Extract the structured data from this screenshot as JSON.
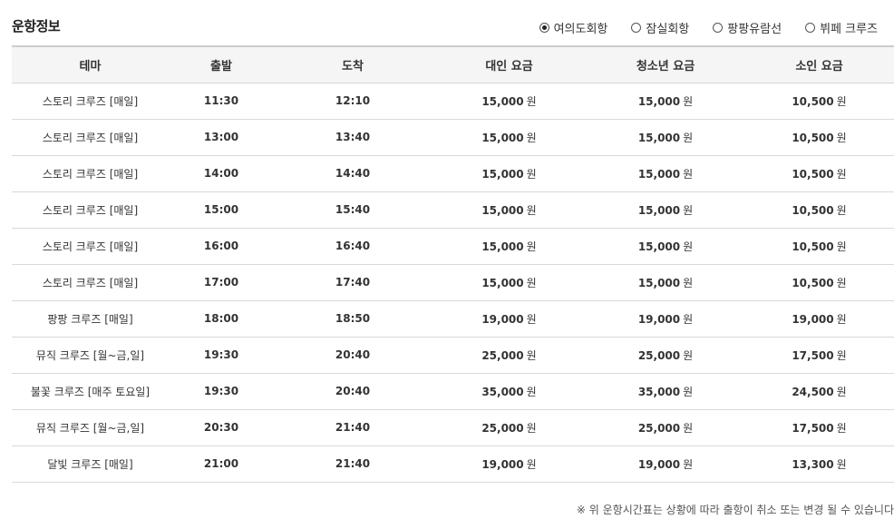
{
  "header": {
    "title": "운항정보"
  },
  "routes": [
    {
      "label": "여의도회항",
      "selected": true
    },
    {
      "label": "잠실회항",
      "selected": false
    },
    {
      "label": "팡팡유람선",
      "selected": false
    },
    {
      "label": "뷔페 크루즈",
      "selected": false
    }
  ],
  "table": {
    "columns": [
      "테마",
      "출발",
      "도착",
      "대인 요금",
      "청소년 요금",
      "소인 요금"
    ],
    "currency_unit": "원",
    "rows": [
      {
        "theme": "스토리 크루즈 [매일]",
        "depart": "11:30",
        "arrive": "12:10",
        "adult": "15,000",
        "youth": "15,000",
        "child": "10,500"
      },
      {
        "theme": "스토리 크루즈 [매일]",
        "depart": "13:00",
        "arrive": "13:40",
        "adult": "15,000",
        "youth": "15,000",
        "child": "10,500"
      },
      {
        "theme": "스토리 크루즈 [매일]",
        "depart": "14:00",
        "arrive": "14:40",
        "adult": "15,000",
        "youth": "15,000",
        "child": "10,500"
      },
      {
        "theme": "스토리 크루즈 [매일]",
        "depart": "15:00",
        "arrive": "15:40",
        "adult": "15,000",
        "youth": "15,000",
        "child": "10,500"
      },
      {
        "theme": "스토리 크루즈 [매일]",
        "depart": "16:00",
        "arrive": "16:40",
        "adult": "15,000",
        "youth": "15,000",
        "child": "10,500"
      },
      {
        "theme": "스토리 크루즈 [매일]",
        "depart": "17:00",
        "arrive": "17:40",
        "adult": "15,000",
        "youth": "15,000",
        "child": "10,500"
      },
      {
        "theme": "팡팡 크루즈 [매일]",
        "depart": "18:00",
        "arrive": "18:50",
        "adult": "19,000",
        "youth": "19,000",
        "child": "19,000"
      },
      {
        "theme": "뮤직 크루즈 [월~금,일]",
        "depart": "19:30",
        "arrive": "20:40",
        "adult": "25,000",
        "youth": "25,000",
        "child": "17,500"
      },
      {
        "theme": "불꽃 크루즈 [매주 토요일]",
        "depart": "19:30",
        "arrive": "20:40",
        "adult": "35,000",
        "youth": "35,000",
        "child": "24,500"
      },
      {
        "theme": "뮤직 크루즈 [월~금,일]",
        "depart": "20:30",
        "arrive": "21:40",
        "adult": "25,000",
        "youth": "25,000",
        "child": "17,500"
      },
      {
        "theme": "달빛 크루즈 [매일]",
        "depart": "21:00",
        "arrive": "21:40",
        "adult": "19,000",
        "youth": "19,000",
        "child": "13,300"
      }
    ]
  },
  "footnote": "※ 위 운항시간표는 상황에 따라 출항이 취소 또는 변경 될 수 있습니다"
}
